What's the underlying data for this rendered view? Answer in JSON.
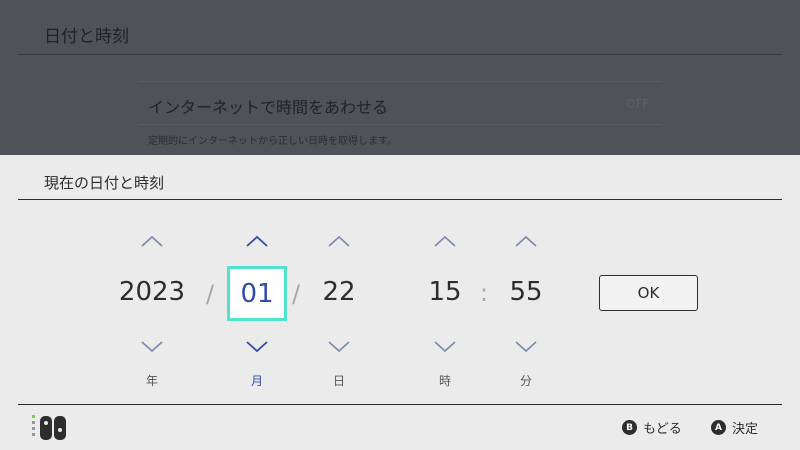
{
  "background": {
    "title": "日付と時刻",
    "row": {
      "label": "インターネットで時間をあわせる",
      "value": "OFF",
      "description": "定期的にインターネットから正しい日時を取得します。"
    }
  },
  "dialog": {
    "title": "現在の日付と時刻",
    "fields": {
      "year": {
        "value": "2023",
        "unit": "年"
      },
      "month": {
        "value": "01",
        "unit": "月"
      },
      "day": {
        "value": "22",
        "unit": "日"
      },
      "hour": {
        "value": "15",
        "unit": "時"
      },
      "minute": {
        "value": "55",
        "unit": "分"
      }
    },
    "date_separator": "/",
    "time_separator": ":",
    "focused_field": "month",
    "ok_label": "OK"
  },
  "footer": {
    "back_button_glyph": "B",
    "back_label": "もどる",
    "confirm_button_glyph": "A",
    "confirm_label": "決定"
  },
  "icons": {
    "up": "chevron-up-icon",
    "down": "chevron-down-icon",
    "controller": "joy-con-controller-icon"
  },
  "colors": {
    "focus_border": "#52e3cf",
    "focus_text": "#2f4ca8",
    "arrow_default": "#7a8aa8",
    "arrow_focused": "#2f4ca8"
  }
}
